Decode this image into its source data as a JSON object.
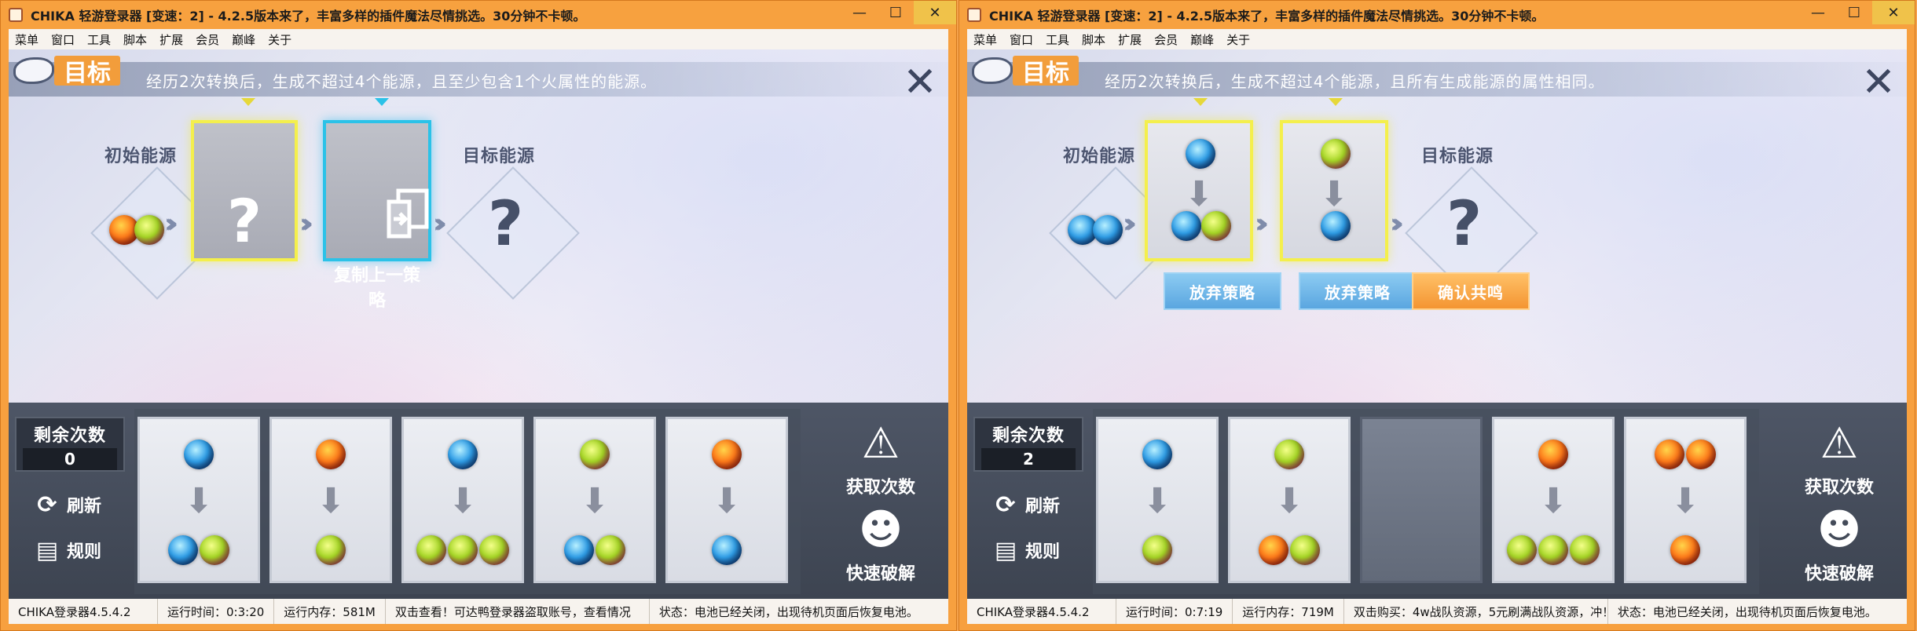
{
  "windows": [
    {
      "title": "CHIKA 轻游登录器 [变速：2] - 4.2.5版本来了，丰富多样的插件魔法尽情挑选。30分钟不卡顿。",
      "menu": [
        "菜单",
        "窗口",
        "工具",
        "脚本",
        "扩展",
        "会员",
        "巅峰",
        "关于"
      ],
      "goal_badge": "目标",
      "goal_text": "经历2次转换后，生成不超过4个能源，且至少包含1个火属性的能源。",
      "initial_label": "初始能源",
      "target_label": "目标能源",
      "initial_orbs": [
        "fire",
        "wood"
      ],
      "card1_text": "?",
      "card2_text": "复制上一策略",
      "remaining_label": "剩余次数",
      "remaining_value": "0",
      "refresh_label": "刷新",
      "rules_label": "规则",
      "get_count_label": "获取次数",
      "quick_crack_label": "快速破解",
      "tray_cards": [
        {
          "top": [
            "water"
          ],
          "bottom": [
            "water",
            "wood"
          ]
        },
        {
          "top": [
            "fire"
          ],
          "bottom": [
            "wood"
          ]
        },
        {
          "top": [
            "water"
          ],
          "bottom": [
            "wood",
            "wood",
            "wood"
          ]
        },
        {
          "top": [
            "wood"
          ],
          "bottom": [
            "water",
            "wood"
          ]
        },
        {
          "top": [
            "fire"
          ],
          "bottom": [
            "water"
          ]
        }
      ],
      "status": {
        "version": "CHIKA登录器4.5.4.2",
        "runtime": "运行时间：0:3:20",
        "memory": "运行内存：581M",
        "notice": "双击查看！可达鸭登录器盗取账号，查看情况",
        "state": "状态：电池已经关闭，出现待机页面后恢复电池。"
      }
    },
    {
      "title": "CHIKA 轻游登录器 [变速：2] - 4.2.5版本来了，丰富多样的插件魔法尽情挑选。30分钟不卡顿。",
      "menu": [
        "菜单",
        "窗口",
        "工具",
        "脚本",
        "扩展",
        "会员",
        "巅峰",
        "关于"
      ],
      "goal_badge": "目标",
      "goal_text": "经历2次转换后，生成不超过4个能源，且所有生成能源的属性相同。",
      "initial_label": "初始能源",
      "target_label": "目标能源",
      "initial_orbs": [
        "water",
        "water"
      ],
      "slot1": {
        "top": [
          "water"
        ],
        "bottom": [
          "water",
          "wood"
        ]
      },
      "slot2": {
        "top": [
          "wood"
        ],
        "bottom": [
          "water"
        ]
      },
      "abandon1_label": "放弃策略",
      "abandon2_label": "放弃策略",
      "confirm_label": "确认共鸣",
      "remaining_label": "剩余次数",
      "remaining_value": "2",
      "refresh_label": "刷新",
      "rules_label": "规则",
      "get_count_label": "获取次数",
      "quick_crack_label": "快速破解",
      "tray_cards": [
        {
          "top": [
            "water"
          ],
          "bottom": [
            "wood"
          ]
        },
        {
          "top": [
            "wood"
          ],
          "bottom": [
            "fire",
            "wood"
          ]
        },
        {
          "blank": true
        },
        {
          "top": [
            "fire"
          ],
          "bottom": [
            "wood",
            "wood",
            "wood"
          ]
        },
        {
          "top": [
            "fire",
            "fire"
          ],
          "bottom": [
            "fire"
          ]
        }
      ],
      "status": {
        "version": "CHIKA登录器4.5.4.2",
        "runtime": "运行时间：0:7:19",
        "memory": "运行内存：719M",
        "notice": "双击购买：4w战队资源，5元刷满战队资源，冲！",
        "state": "状态：电池已经关闭，出现待机页面后恢复电池。"
      }
    }
  ]
}
